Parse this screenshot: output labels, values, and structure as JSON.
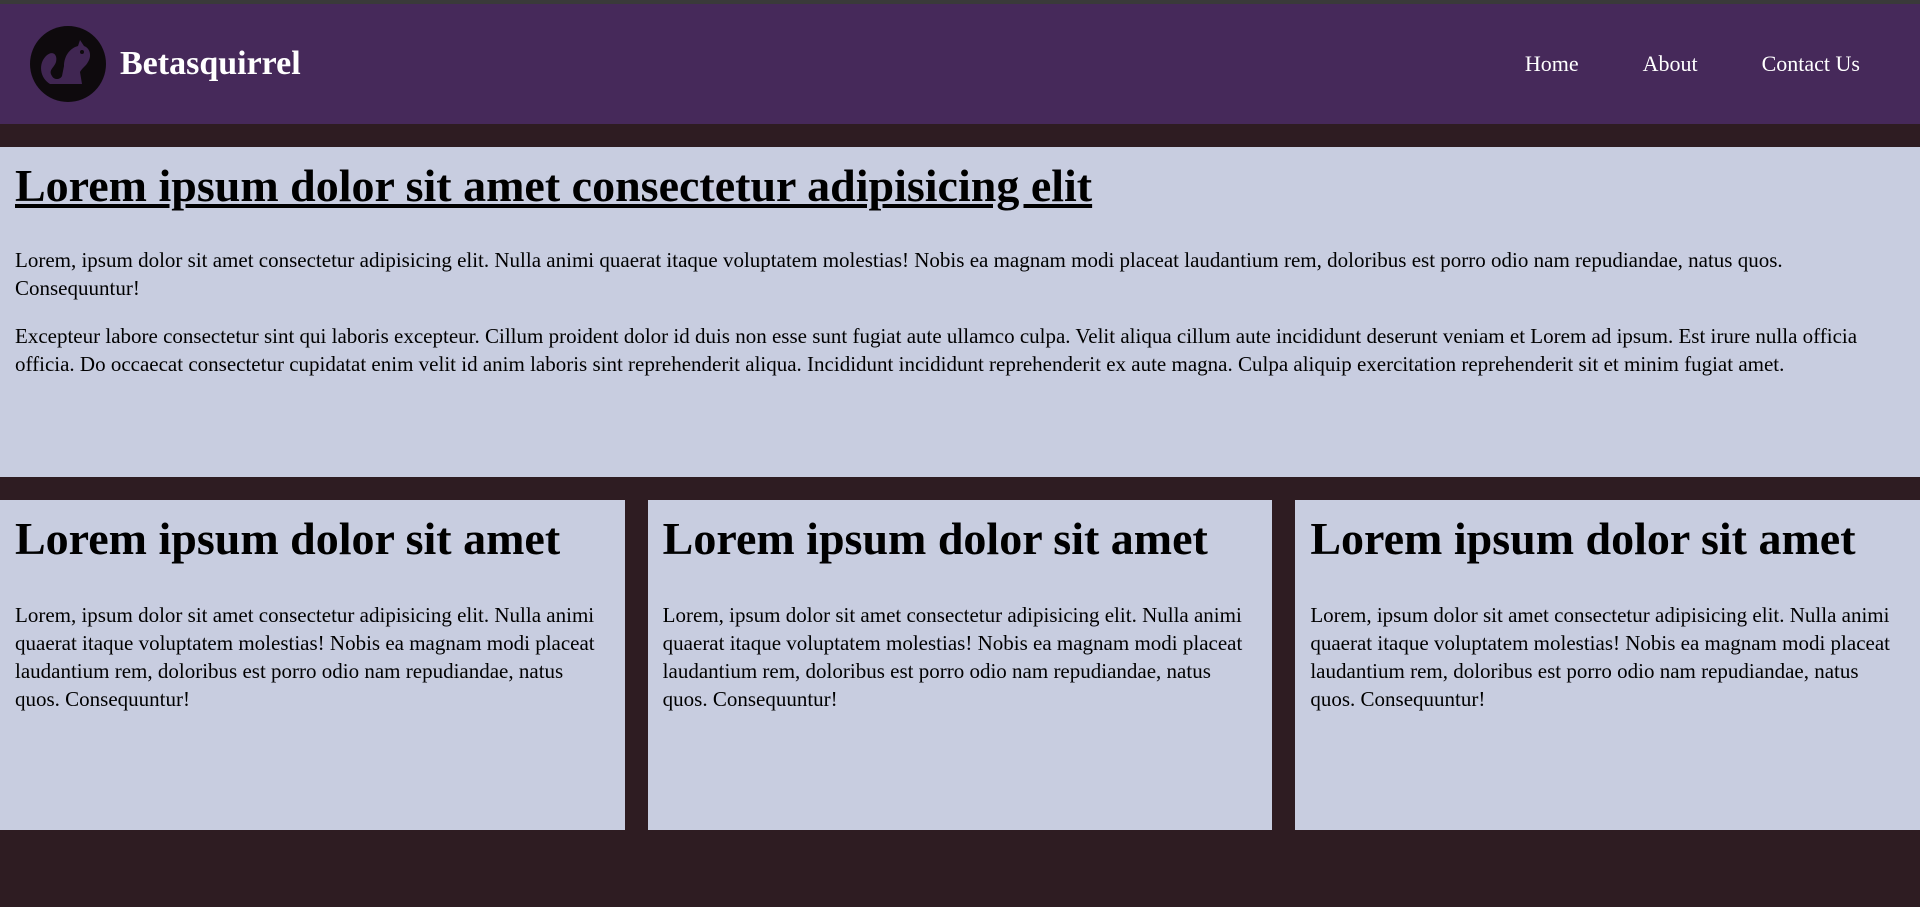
{
  "header": {
    "brand_name": "Betasquirrel",
    "logo_icon": "squirrel-logo-icon",
    "nav": [
      {
        "label": "Home"
      },
      {
        "label": "About"
      },
      {
        "label": "Contact Us"
      }
    ]
  },
  "hero": {
    "title": "Lorem ipsum dolor sit amet consectetur adipisicing elit",
    "paragraphs": [
      "Lorem, ipsum dolor sit amet consectetur adipisicing elit. Nulla animi quaerat itaque voluptatem molestias! Nobis ea magnam modi placeat laudantium rem, doloribus est porro odio nam repudiandae, natus quos. Consequuntur!",
      "Excepteur labore consectetur sint qui laboris excepteur. Cillum proident dolor id duis non esse sunt fugiat aute ullamco culpa. Velit aliqua cillum aute incididunt deserunt veniam et Lorem ad ipsum. Est irure nulla officia officia. Do occaecat consectetur cupidatat enim velit id anim laboris sint reprehenderit aliqua. Incididunt incididunt reprehenderit ex aute magna. Culpa aliquip exercitation reprehenderit sit et minim fugiat amet."
    ]
  },
  "cards": [
    {
      "title": "Lorem ipsum dolor sit amet",
      "text": "Lorem, ipsum dolor sit amet consectetur adipisicing elit. Nulla animi quaerat itaque voluptatem molestias! Nobis ea magnam modi placeat laudantium rem, doloribus est porro odio nam repudiandae, natus quos. Consequuntur!"
    },
    {
      "title": "Lorem ipsum dolor sit amet",
      "text": "Lorem, ipsum dolor sit amet consectetur adipisicing elit. Nulla animi quaerat itaque voluptatem molestias! Nobis ea magnam modi placeat laudantium rem, doloribus est porro odio nam repudiandae, natus quos. Consequuntur!"
    },
    {
      "title": "Lorem ipsum dolor sit amet",
      "text": "Lorem, ipsum dolor sit amet consectetur adipisicing elit. Nulla animi quaerat itaque voluptatem molestias! Nobis ea magnam modi placeat laudantium rem, doloribus est porro odio nam repudiandae, natus quos. Consequuntur!"
    }
  ],
  "colors": {
    "header_bg": "#46295a",
    "page_bg": "#2e1c22",
    "panel_bg": "#c8cde0",
    "text": "#000000",
    "nav_text": "#ffffff"
  }
}
